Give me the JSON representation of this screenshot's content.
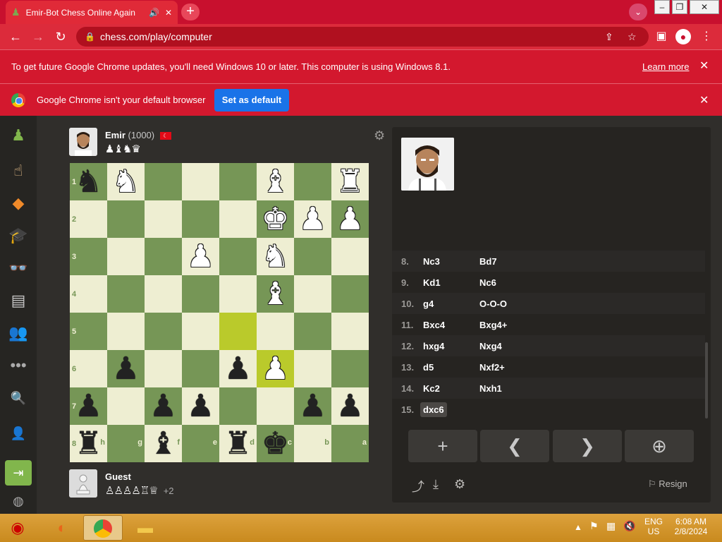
{
  "browser": {
    "tab_title": "Emir-Bot Chess Online Again",
    "url": "chess.com/play/computer",
    "new_tab_label": "+"
  },
  "infobar1": {
    "message": "To get future Google Chrome updates, you'll need Windows 10 or later. This computer is using Windows 8.1.",
    "link": "Learn more"
  },
  "infobar2": {
    "message": "Google Chrome isn't your default browser",
    "button": "Set as default"
  },
  "top_player": {
    "name": "Emir",
    "rating": "(1000)",
    "captured": "♟♝♞♛"
  },
  "bottom_player": {
    "name": "Guest",
    "captured": "♙♙♙♙♖♕",
    "advantage": "+2"
  },
  "board": {
    "rows": [
      {
        "rank": "1",
        "cells": [
          "bN",
          "wN",
          "",
          "",
          "",
          "wB",
          "",
          "wR"
        ]
      },
      {
        "rank": "2",
        "cells": [
          "",
          "",
          "",
          "",
          "",
          "wK",
          "wP",
          "wP"
        ]
      },
      {
        "rank": "3",
        "cells": [
          "",
          "",
          "",
          "wP",
          "",
          "wN",
          "",
          ""
        ]
      },
      {
        "rank": "4",
        "cells": [
          "",
          "",
          "",
          "",
          "",
          "wB",
          "",
          ""
        ]
      },
      {
        "rank": "5",
        "cells": [
          "",
          "",
          "",
          "",
          "",
          "",
          "",
          ""
        ]
      },
      {
        "rank": "6",
        "cells": [
          "",
          "bP",
          "",
          "",
          "bP",
          "wP",
          "",
          ""
        ]
      },
      {
        "rank": "7",
        "cells": [
          "bP",
          "",
          "bP",
          "bP",
          "",
          "",
          "bP",
          "bP"
        ]
      },
      {
        "rank": "8",
        "cells": [
          "bR",
          "",
          "bB",
          "",
          "bR",
          "bK",
          "",
          ""
        ]
      }
    ],
    "files": [
      "h",
      "g",
      "f",
      "e",
      "d",
      "c",
      "b",
      "a"
    ],
    "highlighted": [
      [
        4,
        4
      ],
      [
        5,
        5
      ]
    ]
  },
  "moves": [
    {
      "num": "8.",
      "white": "Nc3",
      "black": "Bd7"
    },
    {
      "num": "9.",
      "white": "Kd1",
      "black": "Nc6"
    },
    {
      "num": "10.",
      "white": "g4",
      "black": "O-O-O"
    },
    {
      "num": "11.",
      "white": "Bxc4",
      "black": "Bxg4+"
    },
    {
      "num": "12.",
      "white": "hxg4",
      "black": "Nxg4"
    },
    {
      "num": "13.",
      "white": "d5",
      "black": "Nxf2+"
    },
    {
      "num": "14.",
      "white": "Kc2",
      "black": "Nxh1"
    },
    {
      "num": "15.",
      "white": "dxc6",
      "black": ""
    }
  ],
  "controls": {
    "new_game": "+",
    "prev": "❮",
    "next": "❯",
    "analysis": "⊕"
  },
  "resign_label": "Resign",
  "taskbar": {
    "lang": "ENG",
    "region": "US",
    "time": "6:08 AM",
    "date": "2/8/2024"
  }
}
